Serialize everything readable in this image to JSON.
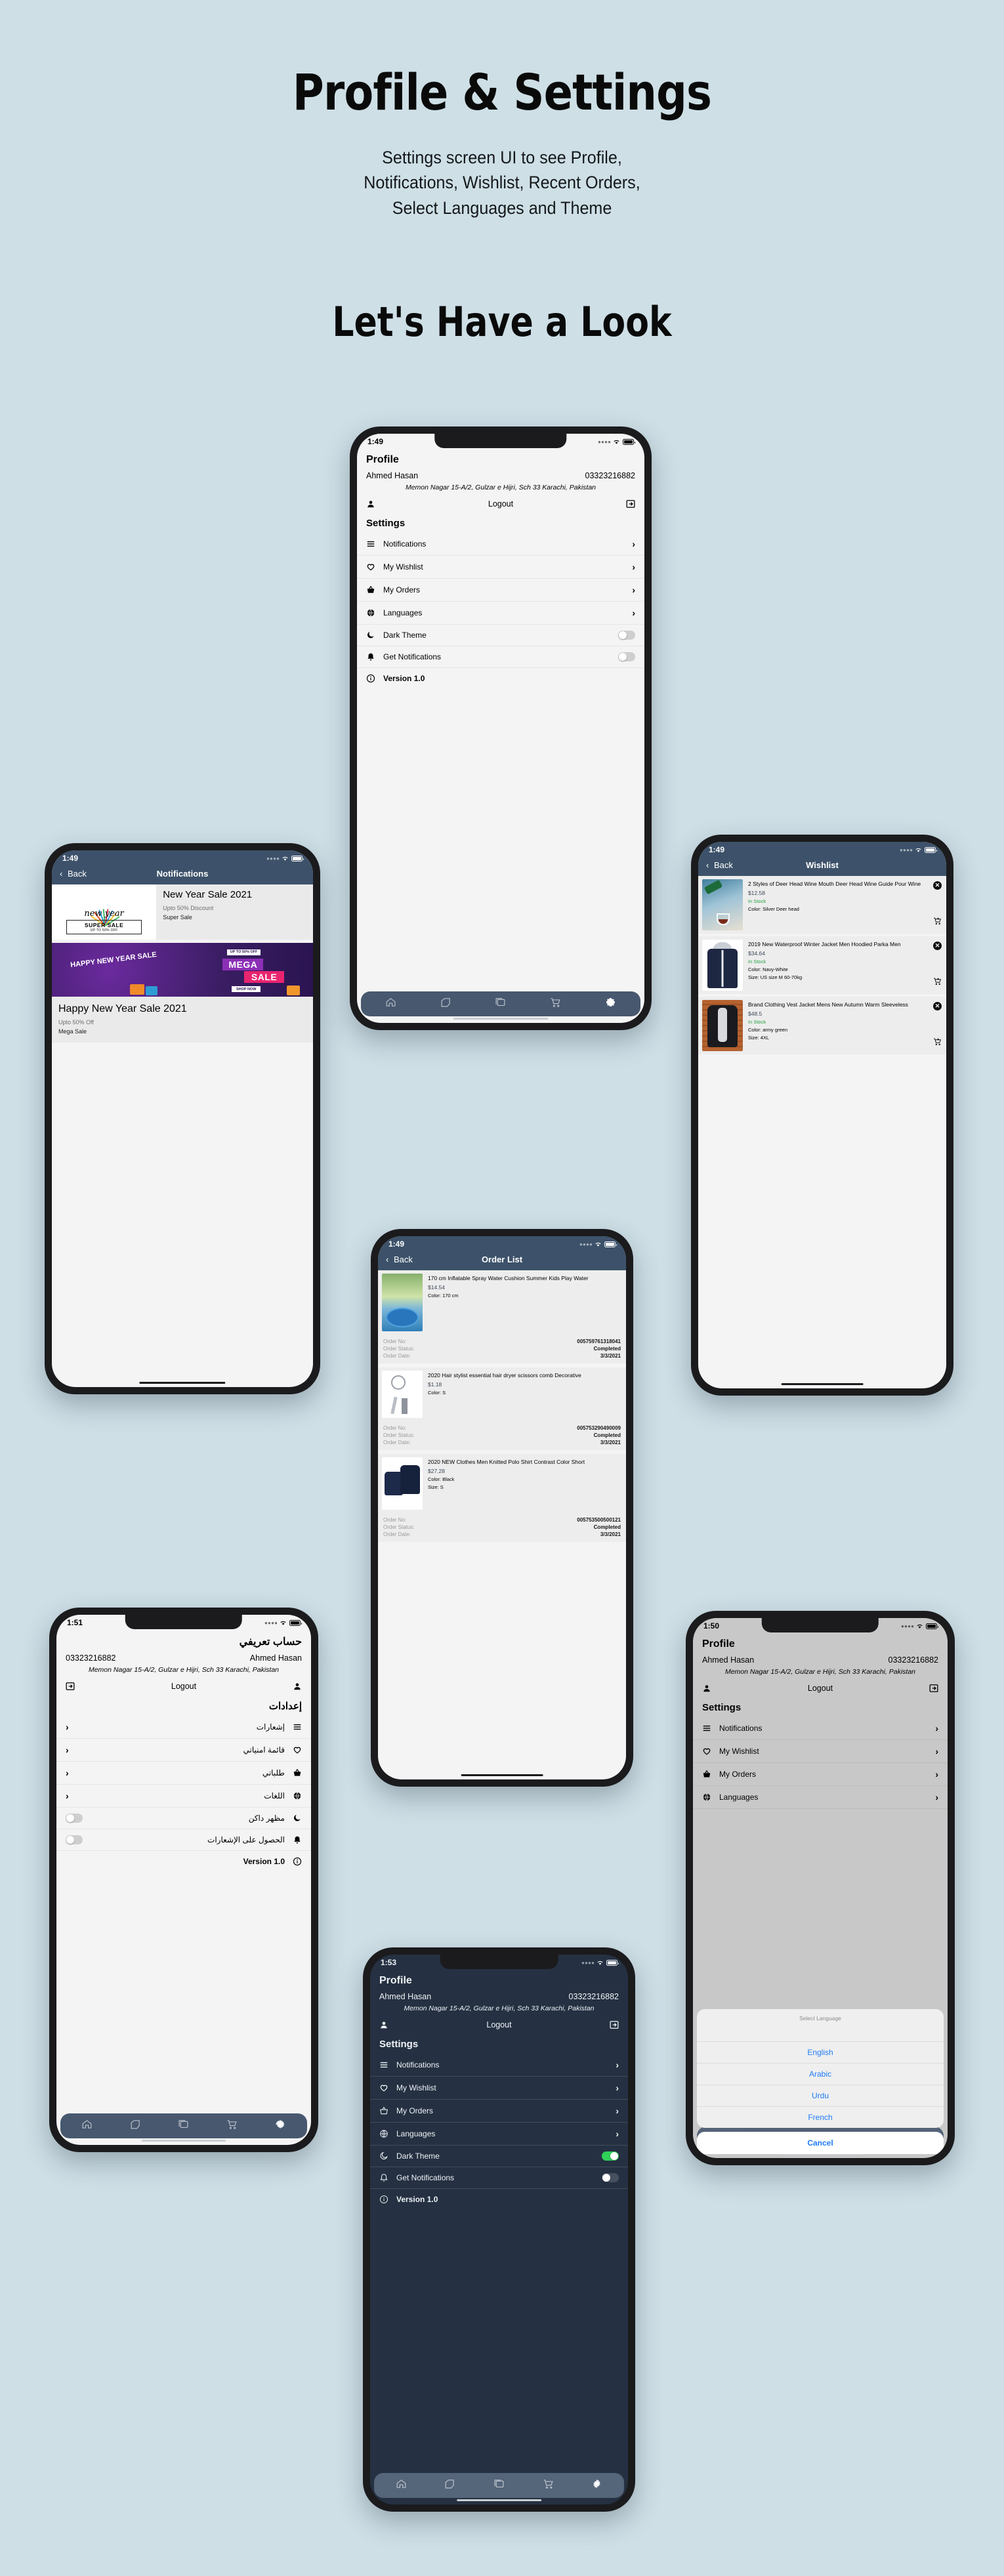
{
  "page": {
    "title": "Profile & Settings",
    "subtitle_lines": [
      "Settings screen UI to see Profile,",
      "Notifications, Wishlist, Recent Orders,",
      "Select Languages and Theme"
    ],
    "cta": "Let's Have a Look",
    "background_color": "#cedfe6",
    "accent_color": "#3d526a",
    "toggle_on_color": "#30d158",
    "link_color": "#1f7bf4"
  },
  "profile": {
    "status_time": "1:49",
    "title": "Profile",
    "name": "Ahmed Hasan",
    "phone": "03323216882",
    "address": "Memon Nagar 15-A/2, Gulzar e Hijri, Sch 33 Karachi, Pakistan",
    "logout_label": "Logout",
    "settings_heading": "Settings",
    "rows": [
      {
        "label": "Notifications",
        "icon": "list-icon",
        "type": "chevron"
      },
      {
        "label": "My Wishlist",
        "icon": "heart-icon",
        "type": "chevron"
      },
      {
        "label": "My Orders",
        "icon": "basket-icon",
        "type": "chevron"
      },
      {
        "label": "Languages",
        "icon": "globe-icon",
        "type": "chevron"
      },
      {
        "label": "Dark Theme",
        "icon": "moon-icon",
        "type": "toggle",
        "on": false
      },
      {
        "label": "Get Notifications",
        "icon": "bell-icon",
        "type": "toggle",
        "on": false
      },
      {
        "label": "Version 1.0",
        "icon": "info-icon",
        "type": "plain"
      }
    ],
    "tabs": [
      {
        "name": "home-icon"
      },
      {
        "name": "tag-icon"
      },
      {
        "name": "gallery-icon"
      },
      {
        "name": "cart-icon"
      },
      {
        "name": "gear-icon",
        "active": true
      }
    ]
  },
  "notifications": {
    "status_time": "1:49",
    "back_label": "Back",
    "title": "Notifications",
    "items": [
      {
        "title": "New Year Sale 2021",
        "subtitle": "Upto 50% Discount",
        "note": "Super Sale",
        "thumb_text": "new year",
        "thumb_year": "2021",
        "thumb_badge": "SUPER SALE",
        "thumb_badge_sub": "UP TO 50% OFF"
      },
      {
        "title": "Happy New Year Sale 2021",
        "subtitle": "Upto 50% Off",
        "note": "Mega Sale",
        "banner_left": "HAPPY NEW YEAR SALE",
        "banner_top": "UP TO 50% OFF",
        "banner_main": "MEGA",
        "banner_main2": "SALE",
        "banner_cta": "SHOP NOW"
      }
    ]
  },
  "wishlist": {
    "status_time": "1:49",
    "back_label": "Back",
    "title": "Wishlist",
    "items": [
      {
        "name": "2 Styles of Deer Head Wine Mouth Deer Head Wine Guide Pour Wine",
        "price": "$12.58",
        "stock": "In Stock",
        "color": "Color: Silver Deer head",
        "size": ""
      },
      {
        "name": "2019 New Waterproof Winter Jacket Men Hoodied Parka Men",
        "price": "$34.64",
        "stock": "In Stock",
        "color": "Color: Navy-White",
        "size": "Size: US size M 60-70kg"
      },
      {
        "name": "Brand Clothing Vest Jacket Mens New Autumn Warm Sleeveless",
        "price": "$48.5",
        "stock": "In Stock",
        "color": "Color: army green",
        "size": "Size: 4XL"
      }
    ]
  },
  "orders": {
    "status_time": "1:49",
    "back_label": "Back",
    "title": "Order List",
    "labels": {
      "no": "Order No:",
      "status": "Order Status:",
      "date": "Order Date:"
    },
    "items": [
      {
        "name": "170 cm Inflatable Spray Water Cushion Summer Kids Play Water",
        "price": "$14.54",
        "color": "Color: 170 cm",
        "size": "",
        "order_no": "005759761318041",
        "status": "Completed",
        "date": "3/3/2021"
      },
      {
        "name": "2020 Hair stylist essential hair dryer scissors comb Decorative",
        "price": "$1.18",
        "color": "Color: S",
        "size": "",
        "order_no": "005753290490009",
        "status": "Completed",
        "date": "3/3/2021"
      },
      {
        "name": "2020 NEW Clothes Men Knitted Polo Shirt Contrast Color Short",
        "price": "$27.28",
        "color": "Color: Black",
        "size": "Size: S",
        "order_no": "005753500500121",
        "status": "Completed",
        "date": "3/3/2021"
      }
    ]
  },
  "arabic": {
    "status_time": "1:51",
    "title": "حساب تعريفي",
    "name": "Ahmed Hasan",
    "phone": "03323216882",
    "address": "Memon Nagar 15-A/2, Gulzar e Hijri, Sch 33 Karachi, Pakistan",
    "logout_label": "Logout",
    "settings_heading": "إعدادات",
    "rows": [
      {
        "label": "إشعارات",
        "icon": "list-icon",
        "type": "chevron"
      },
      {
        "label": "قائمة امنياتي",
        "icon": "heart-icon",
        "type": "chevron"
      },
      {
        "label": "طلباتي",
        "icon": "basket-icon",
        "type": "chevron"
      },
      {
        "label": "اللغات",
        "icon": "globe-icon",
        "type": "chevron"
      },
      {
        "label": "مظهر داكن",
        "icon": "moon-icon",
        "type": "toggle",
        "on": false
      },
      {
        "label": "الحصول على الإشعارات",
        "icon": "bell-icon",
        "type": "toggle",
        "on": false
      },
      {
        "label": "Version 1.0",
        "icon": "info-icon",
        "type": "plain"
      }
    ]
  },
  "languages": {
    "status_time": "1:50",
    "title": "Profile",
    "name": "Ahmed Hasan",
    "phone": "03323216882",
    "address": "Memon Nagar 15-A/2, Gulzar e Hijri, Sch 33 Karachi, Pakistan",
    "logout_label": "Logout",
    "settings_heading": "Settings",
    "rows": [
      {
        "label": "Notifications",
        "icon": "list-icon"
      },
      {
        "label": "My Wishlist",
        "icon": "heart-icon"
      },
      {
        "label": "My Orders",
        "icon": "basket-icon"
      },
      {
        "label": "Languages",
        "icon": "globe-icon"
      }
    ],
    "sheet": {
      "heading": "Select Language",
      "options": [
        "English",
        "Arabic",
        "Urdu",
        "French"
      ],
      "cancel": "Cancel"
    }
  },
  "darktheme": {
    "status_time": "1:53",
    "title": "Profile",
    "name": "Ahmed Hasan",
    "phone": "03323216882",
    "address": "Memon Nagar 15-A/2, Gulzar e Hijri, Sch 33 Karachi, Pakistan",
    "logout_label": "Logout",
    "settings_heading": "Settings",
    "rows": [
      {
        "label": "Notifications",
        "icon": "list-icon",
        "type": "chevron"
      },
      {
        "label": "My Wishlist",
        "icon": "heart-icon",
        "type": "chevron"
      },
      {
        "label": "My Orders",
        "icon": "basket-icon",
        "type": "chevron"
      },
      {
        "label": "Languages",
        "icon": "globe-icon",
        "type": "chevron"
      },
      {
        "label": "Dark Theme",
        "icon": "moon-icon",
        "type": "toggle",
        "on": true
      },
      {
        "label": "Get Notifications",
        "icon": "bell-icon",
        "type": "toggle",
        "on": false
      },
      {
        "label": "Version 1.0",
        "icon": "info-icon",
        "type": "plain"
      }
    ]
  }
}
